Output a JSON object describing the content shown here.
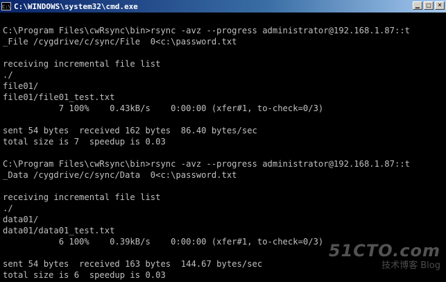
{
  "window": {
    "title": "C:\\WINDOWS\\system32\\cmd.exe",
    "icon_label": "C:\\",
    "controls": [
      "minimize-icon",
      "maximize-icon",
      "close-icon"
    ]
  },
  "console": {
    "lines": [
      "",
      "C:\\Program Files\\cwRsync\\bin>rsync -avz --progress administrator@192.168.1.87::t",
      "_File /cygdrive/c/sync/File  0<c:\\password.txt",
      "",
      "receiving incremental file list",
      "./",
      "file01/",
      "file01/file01_test.txt",
      "           7 100%    0.43kB/s    0:00:00 (xfer#1, to-check=0/3)",
      "",
      "sent 54 bytes  received 162 bytes  86.40 bytes/sec",
      "total size is 7  speedup is 0.03",
      "",
      "C:\\Program Files\\cwRsync\\bin>rsync -avz --progress administrator@192.168.1.87::t",
      "_Data /cygdrive/c/sync/Data  0<c:\\password.txt",
      "",
      "receiving incremental file list",
      "./",
      "data01/",
      "data01/data01_test.txt",
      "           6 100%    0.39kB/s    0:00:00 (xfer#1, to-check=0/3)",
      "",
      "sent 54 bytes  received 163 bytes  144.67 bytes/sec",
      "total size is 6  speedup is 0.03"
    ]
  },
  "watermark": {
    "logo": "51CTO.com",
    "sub": "技术博客  Blog"
  }
}
